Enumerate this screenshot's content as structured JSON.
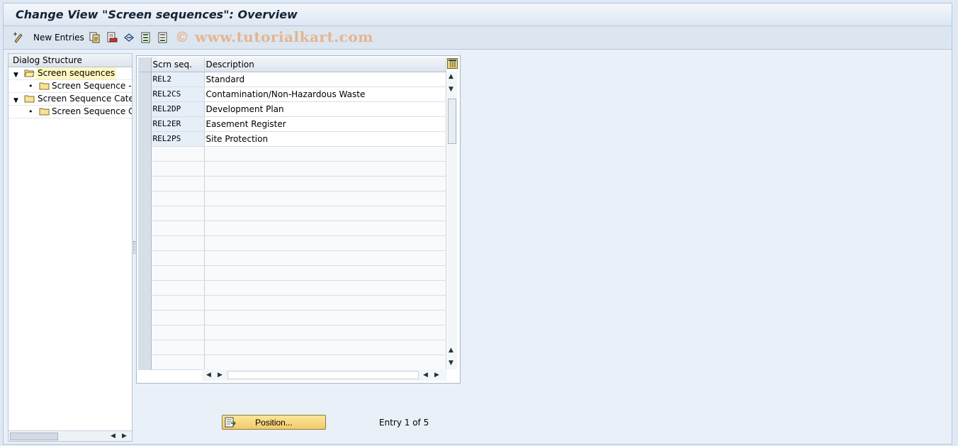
{
  "window": {
    "title": "Change View \"Screen sequences\": Overview"
  },
  "toolbar": {
    "new_entries_label": "New Entries",
    "icons": [
      "edit-pencil-icon",
      "copy-icon",
      "delete-icon",
      "undo-icon",
      "select-all-icon",
      "deselect-all-icon"
    ],
    "watermark": "© www.tutorialkart.com"
  },
  "dialog_structure": {
    "header": "Dialog Structure",
    "items": [
      {
        "label": "Screen sequences",
        "level": 0,
        "expanded": true,
        "selected": true
      },
      {
        "label": "Screen Sequence ->",
        "level": 1
      },
      {
        "label": "Screen Sequence Categ",
        "level": 0,
        "expanded": true
      },
      {
        "label": "Screen Sequence Ca",
        "level": 1
      }
    ]
  },
  "table": {
    "columns": [
      "Scrn seq.",
      "Description"
    ],
    "rows": [
      [
        "REL2",
        "Standard"
      ],
      [
        "REL2CS",
        "Contamination/Non-Hazardous Waste"
      ],
      [
        "REL2DP",
        "Development Plan"
      ],
      [
        "REL2ER",
        "Easement Register"
      ],
      [
        "REL2PS",
        "Site Protection"
      ]
    ],
    "empty_rows": 15
  },
  "footer": {
    "position_button": "Position...",
    "entry_info": "Entry 1 of 5"
  },
  "colors": {
    "title_text": "#142437",
    "key_cell_bg": "#e6eef7",
    "selected_tree_bg": "#fff8c0",
    "button_bg": "#f1c96a"
  }
}
